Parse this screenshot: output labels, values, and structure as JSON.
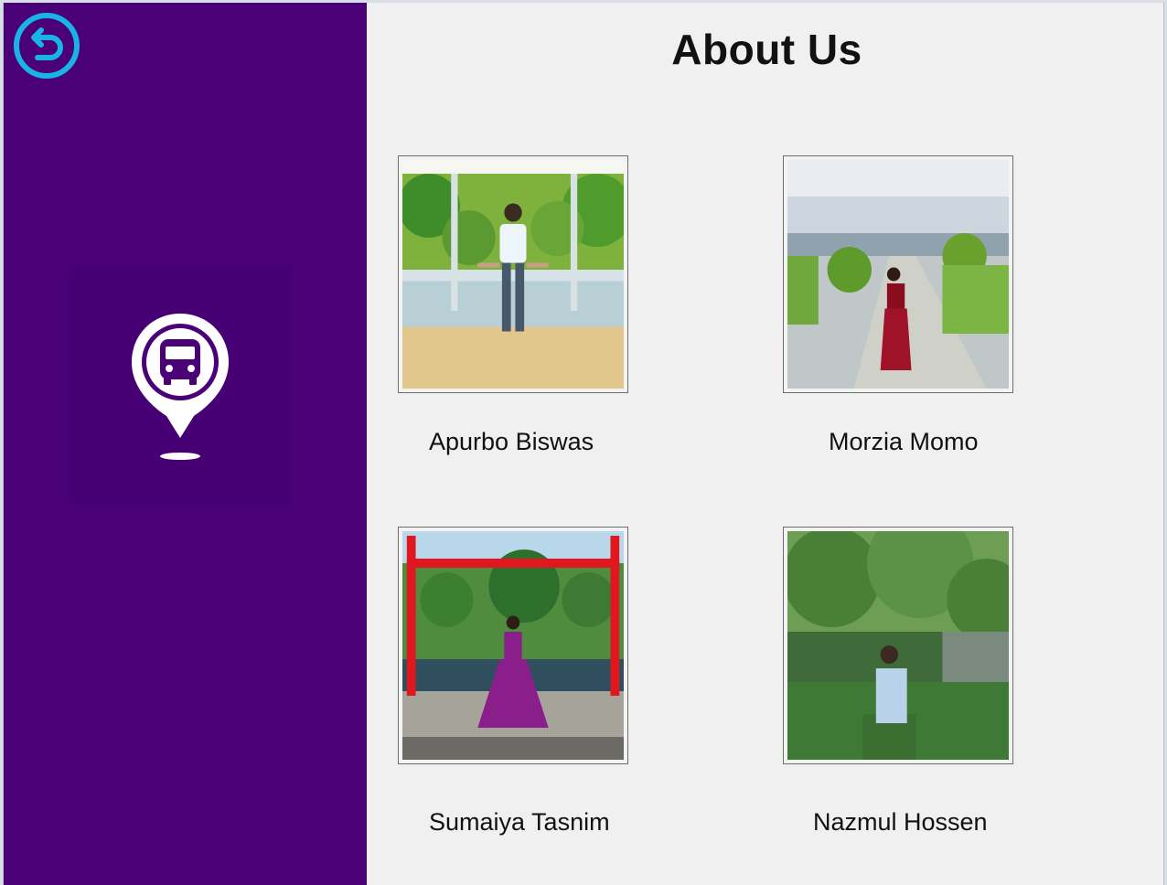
{
  "page": {
    "title": "About Us"
  },
  "sidebar": {
    "back_icon": "back-arrow-circle-icon",
    "logo_icon": "bus-location-pin-icon",
    "colors": {
      "background": "#4a0077",
      "back_icon": "#1ab3e6",
      "logo": "#ffffff"
    }
  },
  "team": [
    {
      "name": "Apurbo Biswas"
    },
    {
      "name": "Morzia Momo"
    },
    {
      "name": "Sumaiya Tasnim"
    },
    {
      "name": "Nazmul Hossen"
    }
  ]
}
